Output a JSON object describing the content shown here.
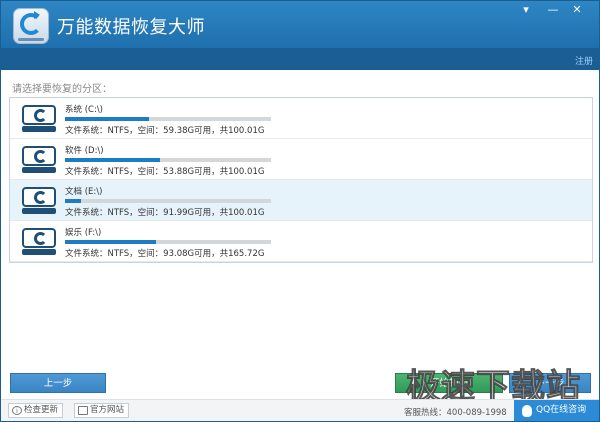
{
  "window": {
    "title": "万能数据恢复大师"
  },
  "controls": {
    "menu": "▾",
    "minimize": "—",
    "close": "✕"
  },
  "header": {
    "register_label": "注册"
  },
  "prompt": "请选择要恢复的分区：",
  "partitions": [
    {
      "name": "系统 (C:\\)",
      "info": "文件系统：NTFS，空间：59.38G可用，共100.01G",
      "used_fraction": 0.41,
      "selected": false
    },
    {
      "name": "软件 (D:\\)",
      "info": "文件系统：NTFS，空间：53.88G可用，共100.01G",
      "used_fraction": 0.46,
      "selected": false
    },
    {
      "name": "文档 (E:\\)",
      "info": "文件系统：NTFS，空间：91.99G可用，共100.01G",
      "used_fraction": 0.08,
      "selected": true
    },
    {
      "name": "娱乐 (F:\\)",
      "info": "文件系统：NTFS，空间：93.08G可用，共165.72G",
      "used_fraction": 0.44,
      "selected": false
    }
  ],
  "buttons": {
    "prev": "上一步",
    "start": "开始扫描",
    "next": "下一步"
  },
  "footer": {
    "check_update": "检查更新",
    "website": "官方网站",
    "hotline": "客服热线：400-089-1998",
    "qq_support": "QQ在线咨询"
  },
  "watermark": "极速下载站",
  "colors": {
    "title_bar": "#1e6fad",
    "progress": "#1f7cc4",
    "selected_row": "#e6f3fb",
    "start_button": "#2f9a57"
  }
}
